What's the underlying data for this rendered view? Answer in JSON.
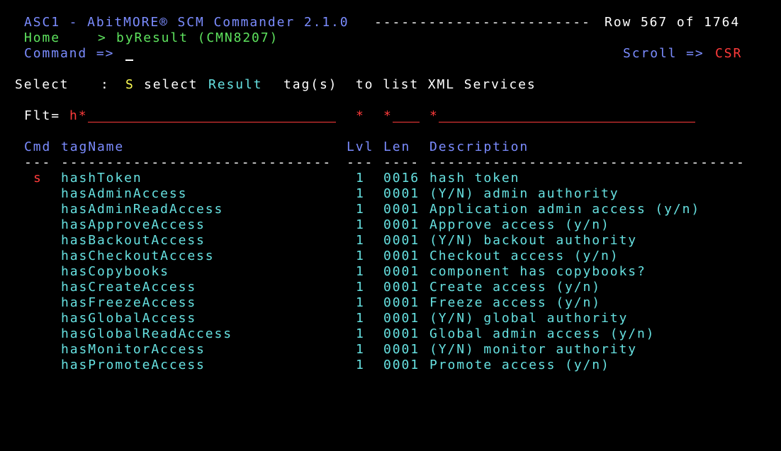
{
  "header": {
    "app_title": "ASC1 - AbitMORE® SCM Commander 2.1.0",
    "dashes": "------------------------",
    "row_info": "Row 567 of 1764",
    "breadcrumb_home": "Home",
    "breadcrumb_sep": ">",
    "breadcrumb_current": "byResult (CMN8207)",
    "command_label": "Command =>",
    "scroll_label": "Scroll =>",
    "scroll_value": "CSR"
  },
  "select_line": {
    "label": "Select",
    "colon": ":",
    "cmd": "S",
    "text1": "select",
    "result": "Result",
    "text2": "tag(s)  to list XML Services"
  },
  "filter": {
    "label": "Flt=",
    "tagname_value": "h*",
    "lvl_value": "*",
    "len_value": "*",
    "desc_value": "*"
  },
  "table": {
    "headers": {
      "cmd": "Cmd",
      "tagname": "tagName",
      "lvl": "Lvl",
      "len": "Len",
      "description": "Description"
    },
    "separators": {
      "cmd": "---",
      "tagname": "------------------------------",
      "lvl": "---",
      "len": "----",
      "description": "-----------------------------------"
    },
    "rows": [
      {
        "cmd": "s",
        "tag": "hashToken",
        "lvl": "1",
        "len": "0016",
        "desc": "hash token"
      },
      {
        "cmd": "",
        "tag": "hasAdminAccess",
        "lvl": "1",
        "len": "0001",
        "desc": "(Y/N) admin authority"
      },
      {
        "cmd": "",
        "tag": "hasAdminReadAccess",
        "lvl": "1",
        "len": "0001",
        "desc": "Application admin access (y/n)"
      },
      {
        "cmd": "",
        "tag": "hasApproveAccess",
        "lvl": "1",
        "len": "0001",
        "desc": "Approve access (y/n)"
      },
      {
        "cmd": "",
        "tag": "hasBackoutAccess",
        "lvl": "1",
        "len": "0001",
        "desc": "(Y/N) backout authority"
      },
      {
        "cmd": "",
        "tag": "hasCheckoutAccess",
        "lvl": "1",
        "len": "0001",
        "desc": "Checkout access (y/n)"
      },
      {
        "cmd": "",
        "tag": "hasCopybooks",
        "lvl": "1",
        "len": "0001",
        "desc": "component has copybooks?"
      },
      {
        "cmd": "",
        "tag": "hasCreateAccess",
        "lvl": "1",
        "len": "0001",
        "desc": "Create access (y/n)"
      },
      {
        "cmd": "",
        "tag": "hasFreezeAccess",
        "lvl": "1",
        "len": "0001",
        "desc": "Freeze access (y/n)"
      },
      {
        "cmd": "",
        "tag": "hasGlobalAccess",
        "lvl": "1",
        "len": "0001",
        "desc": "(Y/N) global authority"
      },
      {
        "cmd": "",
        "tag": "hasGlobalReadAccess",
        "lvl": "1",
        "len": "0001",
        "desc": "Global admin access (y/n)"
      },
      {
        "cmd": "",
        "tag": "hasMonitorAccess",
        "lvl": "1",
        "len": "0001",
        "desc": "(Y/N) monitor authority"
      },
      {
        "cmd": "",
        "tag": "hasPromoteAccess",
        "lvl": "1",
        "len": "0001",
        "desc": "Promote access (y/n)"
      }
    ]
  },
  "colors": {
    "background": "#000000",
    "blue": "#7b8cff",
    "green": "#5ee35e",
    "turquoise": "#66e0e0",
    "red": "#ff3b3b",
    "yellow": "#ffff55",
    "white": "#ffffff"
  }
}
